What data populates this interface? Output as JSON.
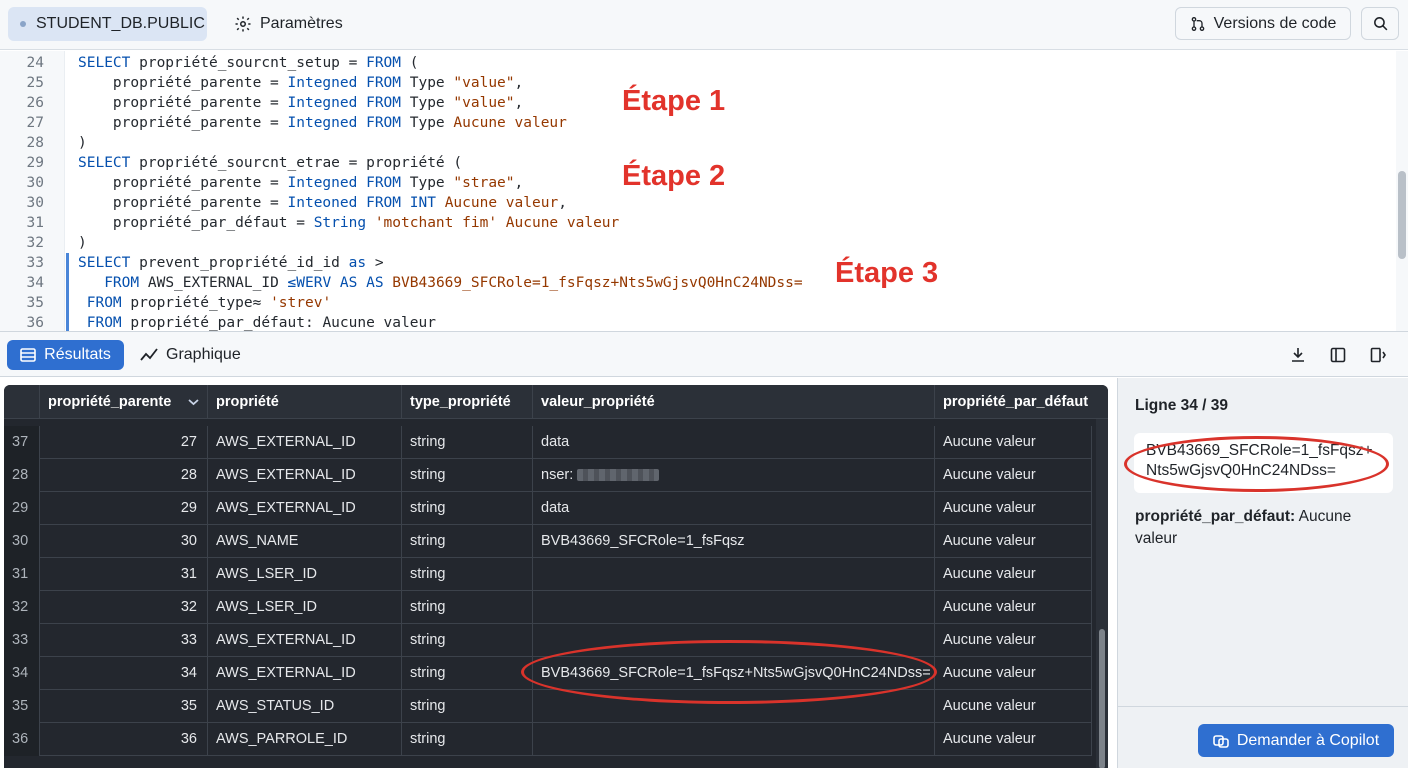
{
  "topbar": {
    "db_tab": "STUDENT_DB.PUBLIC",
    "settings_tab": "Paramètres",
    "versions_button": "Versions de code"
  },
  "editor": {
    "lines": [
      {
        "n": "24",
        "text": "SELECT propriété_sourcnt_setup = FROM ("
      },
      {
        "n": "25",
        "text": "    propriété_parente = Integned FROM Type \"value\","
      },
      {
        "n": "26",
        "text": "    propriété_parente = Integned FROM Type \"value\","
      },
      {
        "n": "27",
        "text": "    propriété_parente = Integned FROM Type Aucune valeur"
      },
      {
        "n": "28",
        "text": ")"
      },
      {
        "n": "29",
        "text": "SELECT propriété_sourcnt_etrae = propriété ("
      },
      {
        "n": "30",
        "text": "    propriété_parente = Integned FROM Type \"strae\","
      },
      {
        "n": "30",
        "text": "    propriété_parente = Inteoned FROM INT Aucune valeur,"
      },
      {
        "n": "31",
        "text": "    propriété_par_défaut = String 'motchant fim' Aucune valeur"
      },
      {
        "n": "32",
        "text": ")"
      },
      {
        "n": "33",
        "text": "SELECT prevent_propriété_id_id as >"
      },
      {
        "n": "34",
        "text": "   FROM AWS_EXTERNAL_ID ≤WERV AS AS BVB43669_SFCRole=1_fsFqsz+Nts5wGjsvQ0HnC24NDss="
      },
      {
        "n": "35",
        "text": " FROM propriété_type≈ 'strev'"
      },
      {
        "n": "36",
        "text": " FROM propriété_par_défaut: Aucune valeur"
      }
    ],
    "annotations": [
      "Étape 1",
      "Étape 2",
      "Étape 3"
    ]
  },
  "results_toolbar": {
    "tab_results": "Résultats",
    "tab_chart": "Graphique"
  },
  "grid": {
    "columns": [
      "propriété_parente",
      "propriété",
      "type_propriété",
      "valeur_propriété",
      "propriété_par_défaut"
    ],
    "rows": [
      {
        "idx": "37",
        "parent": "27",
        "prop": "AWS_EXTERNAL_ID",
        "type": "string",
        "value": "data",
        "default": "Aucune valeur"
      },
      {
        "idx": "28",
        "parent": "28",
        "prop": "AWS_EXTERNAL_ID",
        "type": "string",
        "value": "nser:",
        "default": "Aucune valeur"
      },
      {
        "idx": "29",
        "parent": "29",
        "prop": "AWS_EXTERNAL_ID",
        "type": "string",
        "value": "data",
        "default": "Aucune valeur"
      },
      {
        "idx": "30",
        "parent": "30",
        "prop": "AWS_NAME",
        "type": "string",
        "value": "BVB43669_SFCRole=1_fsFqsz",
        "default": "Aucune valeur"
      },
      {
        "idx": "31",
        "parent": "31",
        "prop": "AWS_LSER_ID",
        "type": "string",
        "value": "",
        "default": "Aucune valeur"
      },
      {
        "idx": "32",
        "parent": "32",
        "prop": "AWS_LSER_ID",
        "type": "string",
        "value": "",
        "default": "Aucune valeur"
      },
      {
        "idx": "33",
        "parent": "33",
        "prop": "AWS_EXTERNAL_ID",
        "type": "string",
        "value": "",
        "default": "Aucune valeur"
      },
      {
        "idx": "34",
        "parent": "34",
        "prop": "AWS_EXTERNAL_ID",
        "type": "string",
        "value": "BVB43669_SFCRole=1_fsFqsz+Nts5wGjsvQ0HnC24NDss=",
        "default": "Aucune valeur"
      },
      {
        "idx": "35",
        "parent": "35",
        "prop": "AWS_STATUS_ID",
        "type": "string",
        "value": "",
        "default": "Aucune valeur"
      },
      {
        "idx": "36",
        "parent": "36",
        "prop": "AWS_PARROLE_ID",
        "type": "string",
        "value": "",
        "default": "Aucune valeur"
      }
    ]
  },
  "side_panel": {
    "title": "Ligne 34 / 39",
    "value": "BVB43669_SFCRole=1_fsFqsz+Nts5wGjsvQ0HnC24NDss=",
    "default_label": "propriété_par_défaut:",
    "default_value": " Aucune valeur",
    "copilot_button": "Demander à Copilot"
  },
  "colors": {
    "accent": "#2f6fd0",
    "annotation_red": "#e2332b",
    "grid_bg": "#23272e"
  },
  "icons": [
    "gear-icon",
    "branch-icon",
    "search-icon",
    "table-icon",
    "chart-line-icon",
    "download-icon",
    "columns-icon",
    "sidebar-toggle-icon",
    "sort-down-icon",
    "copilot-icon"
  ]
}
